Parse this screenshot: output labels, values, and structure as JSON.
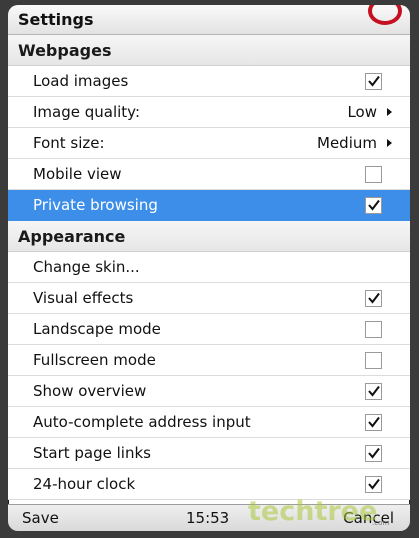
{
  "window": {
    "title": "Settings"
  },
  "sections": [
    {
      "header": "Webpages",
      "items": [
        {
          "label": "Load images",
          "checked": true
        },
        {
          "label": "Image quality:",
          "value": "Low"
        },
        {
          "label": "Font size:",
          "value": "Medium"
        },
        {
          "label": "Mobile view",
          "checked": false
        },
        {
          "label": "Private browsing",
          "checked": true,
          "selected": true
        }
      ]
    },
    {
      "header": "Appearance",
      "items": [
        {
          "label": "Change skin..."
        },
        {
          "label": "Visual effects",
          "checked": true
        },
        {
          "label": "Landscape mode",
          "checked": false
        },
        {
          "label": "Fullscreen mode",
          "checked": false
        },
        {
          "label": "Show overview",
          "checked": true
        },
        {
          "label": "Auto-complete address input",
          "checked": true
        },
        {
          "label": "Start page links",
          "checked": true
        },
        {
          "label": "24-hour clock",
          "checked": true
        }
      ]
    }
  ],
  "bottombar": {
    "left_softkey": "Save",
    "time": "15:53",
    "right_softkey": "Cancel"
  },
  "watermark": {
    "text": "techtree",
    "sub": ".com"
  },
  "colors": {
    "selection": "#3d8ee8",
    "logo": "#c41020"
  }
}
